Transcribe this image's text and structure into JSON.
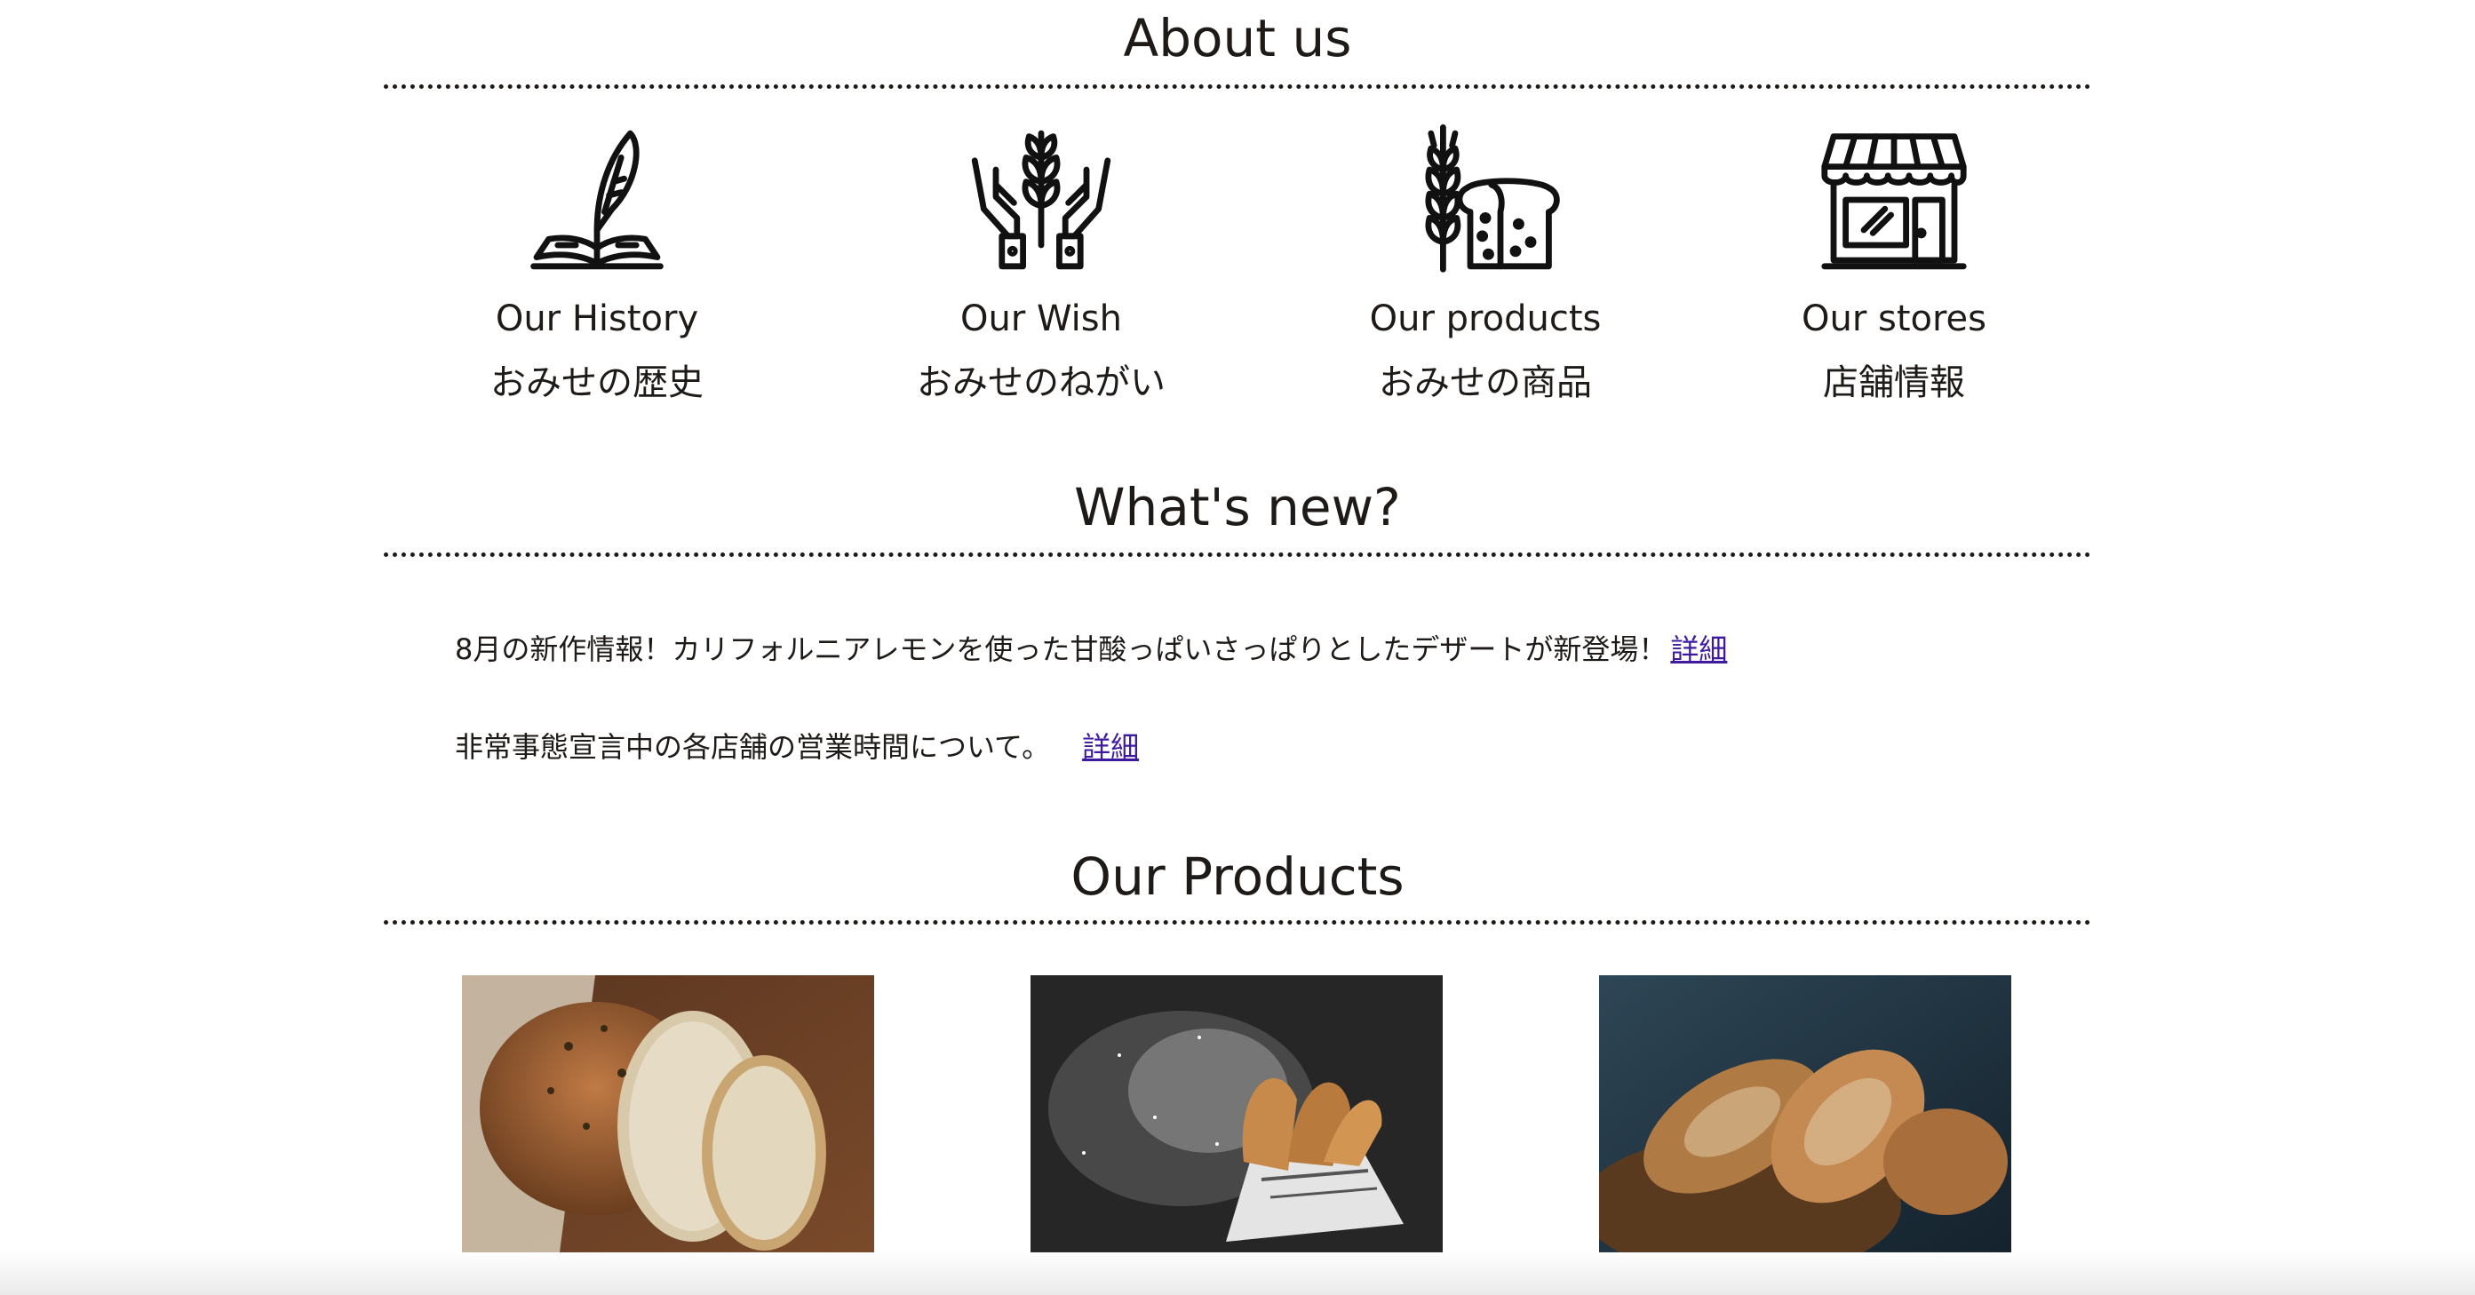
{
  "about": {
    "title": "About us",
    "items": [
      {
        "icon": "book-quill-icon",
        "en": "Our History",
        "ja": "おみせの歴史"
      },
      {
        "icon": "hands-wheat-icon",
        "en": "Our Wish",
        "ja": "おみせのねがい"
      },
      {
        "icon": "wheat-bread-icon",
        "en": "Our products",
        "ja": "おみせの商品"
      },
      {
        "icon": "storefront-icon",
        "en": "Our stores",
        "ja": "店舗情報"
      }
    ]
  },
  "news": {
    "title": "What's new?",
    "items": [
      {
        "text": "8月の新作情報！カリフォルニアレモンを使った甘酸っぱいさっぱりとしたデザートが新登場！",
        "link": "詳細"
      },
      {
        "text": "非常事態宣言中の各店舗の営業時間について。",
        "link": "詳細"
      }
    ]
  },
  "products": {
    "title": "Our Products",
    "items": [
      {
        "image": "sliced-seeded-bread-photo"
      },
      {
        "image": "churros-with-sugar-photo"
      },
      {
        "image": "rustic-bread-basket-photo"
      }
    ]
  },
  "colors": {
    "text": "#1e1a17",
    "link": "#3d1aa0",
    "background": "#ffffff"
  }
}
